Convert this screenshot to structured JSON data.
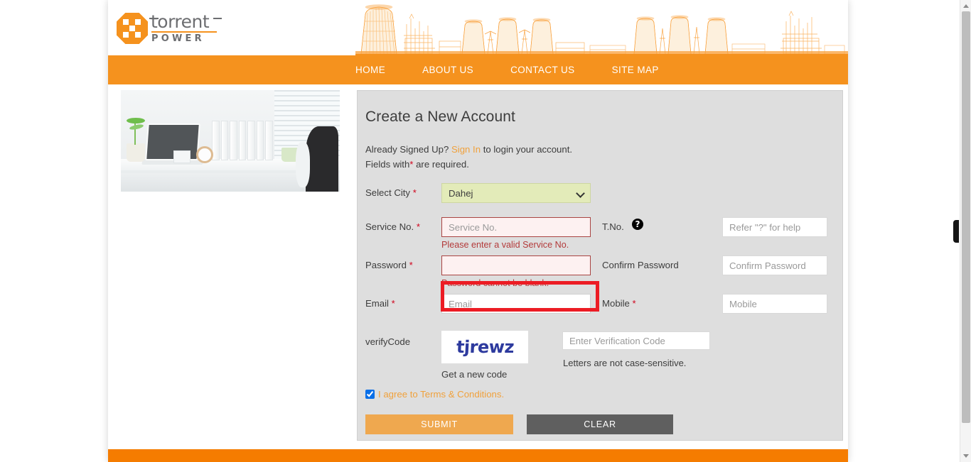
{
  "site": {
    "brand": {
      "word": "torrent",
      "sub": "POWER",
      "banner_alt": "power-plant-line-art"
    },
    "nav": [
      {
        "label": "HOME"
      },
      {
        "label": "ABOUT US"
      },
      {
        "label": "CONTACT US"
      },
      {
        "label": "SITE MAP"
      }
    ]
  },
  "side_photo": {
    "alt": "office-desk-with-laptop-plant-and-binders"
  },
  "form": {
    "title": "Create a New Account",
    "intro_prefix": "Already Signed Up? ",
    "intro_link": "Sign In",
    "intro_suffix": " to login your account.",
    "required_prefix": "Fields with",
    "required_star": "*",
    "required_suffix": " are required.",
    "city": {
      "label": "Select City",
      "required_mark": "*",
      "selected": "Dahej",
      "options": [
        "Dahej"
      ]
    },
    "service_no": {
      "label": "Service No.",
      "required_mark": "*",
      "placeholder": "Service No.",
      "value": "",
      "error": "Please enter a valid Service No."
    },
    "tno": {
      "label": "T.No.",
      "help_icon": "question-mark-circle-icon",
      "placeholder": "Refer \"?\" for help",
      "value": ""
    },
    "password": {
      "label": "Password",
      "required_mark": "*",
      "placeholder": "",
      "value": "",
      "error": "Password cannot be blank."
    },
    "confirm_password": {
      "label": "Confirm Password",
      "placeholder": "Confirm Password",
      "value": ""
    },
    "email": {
      "label": "Email",
      "required_mark": "*",
      "placeholder": "Email",
      "value": ""
    },
    "mobile": {
      "label": "Mobile",
      "required_mark": "*",
      "placeholder": "Mobile",
      "value": ""
    },
    "verify": {
      "label": "verifyCode",
      "captcha_text": "tjrewz",
      "new_code_link": "Get a new code",
      "input_placeholder": "Enter Verification Code",
      "input_value": "",
      "note": "Letters are not case-sensitive."
    },
    "terms": {
      "label": "I agree to Terms & Conditions.",
      "checked": true
    },
    "buttons": {
      "submit": "SUBMIT",
      "clear": "CLEAR"
    }
  },
  "colors": {
    "brand_orange": "#f5921e",
    "footer_orange": "#f57c00",
    "panel_gray": "#dedede",
    "error_red": "#b33a3a",
    "required_red": "#d0021b",
    "link_orange": "#f0a13c",
    "select_green": "#e3ebb9",
    "captcha_blue": "#2d3a9e",
    "submit_orange": "#efa84f",
    "clear_gray": "#5f5f5f",
    "annotation_red": "#ec1c24"
  }
}
